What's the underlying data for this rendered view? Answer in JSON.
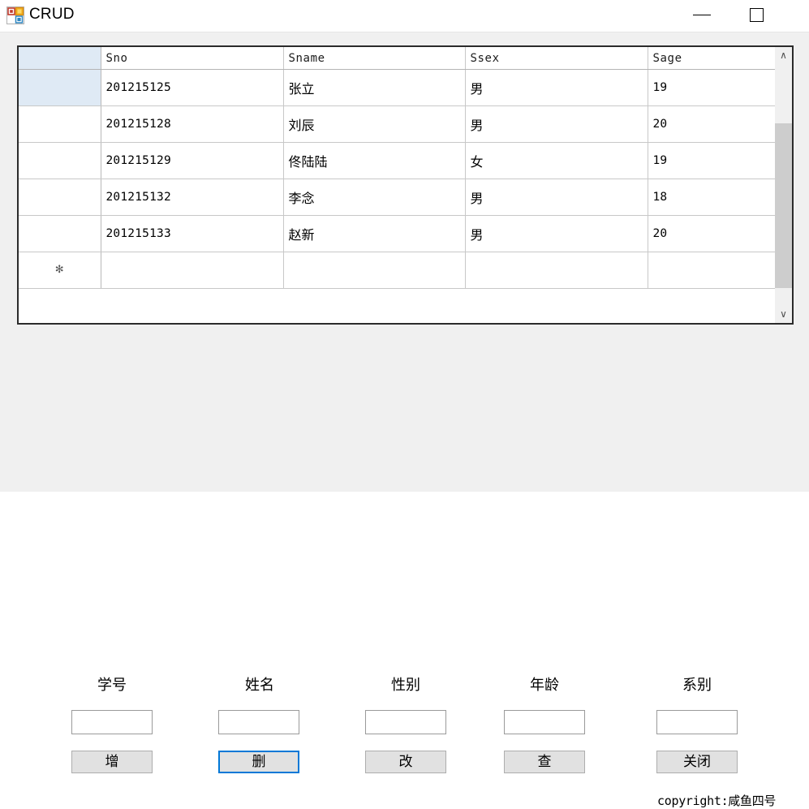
{
  "window": {
    "title": "CRUD",
    "icon": "winforms-app-icon",
    "controls": {
      "minimize_label": "—",
      "maximize_label": "□"
    }
  },
  "grid": {
    "columns": [
      "",
      "Sno",
      "Sname",
      "Ssex",
      "Sage"
    ],
    "rows": [
      {
        "selected": true,
        "marker": "",
        "sno": "201215125",
        "sname": "张立",
        "ssex": "男",
        "sage": "19"
      },
      {
        "selected": false,
        "marker": "",
        "sno": "201215128",
        "sname": "刘辰",
        "ssex": "男",
        "sage": "20"
      },
      {
        "selected": false,
        "marker": "",
        "sno": "201215129",
        "sname": "佟陆陆",
        "ssex": "女",
        "sage": "19"
      },
      {
        "selected": false,
        "marker": "",
        "sno": "201215132",
        "sname": "李念",
        "ssex": "男",
        "sage": "18"
      },
      {
        "selected": false,
        "marker": "",
        "sno": "201215133",
        "sname": "赵新",
        "ssex": "男",
        "sage": "20"
      },
      {
        "selected": false,
        "marker": "✻",
        "sno": "",
        "sname": "",
        "ssex": "",
        "sage": ""
      }
    ],
    "scrollbars": {
      "h_left_glyph": "‹",
      "h_right_glyph": "›",
      "v_up_glyph": "∧",
      "v_down_glyph": "∨"
    }
  },
  "form": {
    "fields": [
      {
        "label": "学号",
        "value": "",
        "placeholder": ""
      },
      {
        "label": "姓名",
        "value": "",
        "placeholder": ""
      },
      {
        "label": "性别",
        "value": "",
        "placeholder": ""
      },
      {
        "label": "年龄",
        "value": "",
        "placeholder": ""
      },
      {
        "label": "系别",
        "value": "",
        "placeholder": ""
      }
    ],
    "buttons": [
      {
        "label": "增",
        "focused": false
      },
      {
        "label": "删",
        "focused": true
      },
      {
        "label": "改",
        "focused": false
      },
      {
        "label": "查",
        "focused": false
      },
      {
        "label": "关闭",
        "focused": false
      }
    ]
  },
  "footer": {
    "copyright": "copyright:咸鱼四号"
  },
  "colors": {
    "accent": "#0078d7",
    "selection": "#dfeaf5",
    "button_face": "#e1e1e1",
    "window_background": "#f0f0f0"
  }
}
